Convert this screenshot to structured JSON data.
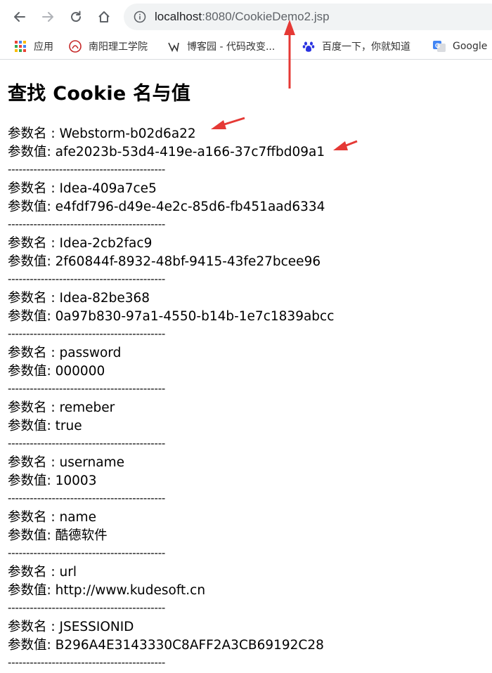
{
  "browser": {
    "url_host": "localhost",
    "url_rest": ":8080/CookieDemo2.jsp"
  },
  "bookmarks": [
    {
      "label": "应用",
      "icon": "apps-grid-icon"
    },
    {
      "label": "南阳理工学院",
      "icon": "school-logo-icon"
    },
    {
      "label": "博客园 - 代码改变...",
      "icon": "cnblogs-icon"
    },
    {
      "label": "百度一下，你就知道",
      "icon": "baidu-paw-icon"
    },
    {
      "label": "Google",
      "icon": "google-translate-icon"
    }
  ],
  "page": {
    "title": "查找 Cookie 名与值",
    "name_prefix": "参数名 : ",
    "value_prefix": "参数值: ",
    "separator": "-------------------------------------------",
    "cookies": [
      {
        "name": "Webstorm-b02d6a22",
        "value": "afe2023b-53d4-419e-a166-37c7ffbd09a1"
      },
      {
        "name": "Idea-409a7ce5",
        "value": "e4fdf796-d49e-4e2c-85d6-fb451aad6334"
      },
      {
        "name": "Idea-2cb2fac9",
        "value": "2f60844f-8932-48bf-9415-43fe27bcee96"
      },
      {
        "name": "Idea-82be368",
        "value": "0a97b830-97a1-4550-b14b-1e7c1839abcc"
      },
      {
        "name": "password",
        "value": "000000"
      },
      {
        "name": "remeber",
        "value": "true"
      },
      {
        "name": "username",
        "value": "10003"
      },
      {
        "name": "name",
        "value": "酷德软件"
      },
      {
        "name": "url",
        "value": "http://www.kudesoft.cn"
      },
      {
        "name": "JSESSIONID",
        "value": "B296A4E3143330C8AFF2A3CB69192C28"
      }
    ]
  },
  "colors": {
    "annotation_arrow": "#e53935",
    "omnibox_bg": "#f1f3f4"
  }
}
